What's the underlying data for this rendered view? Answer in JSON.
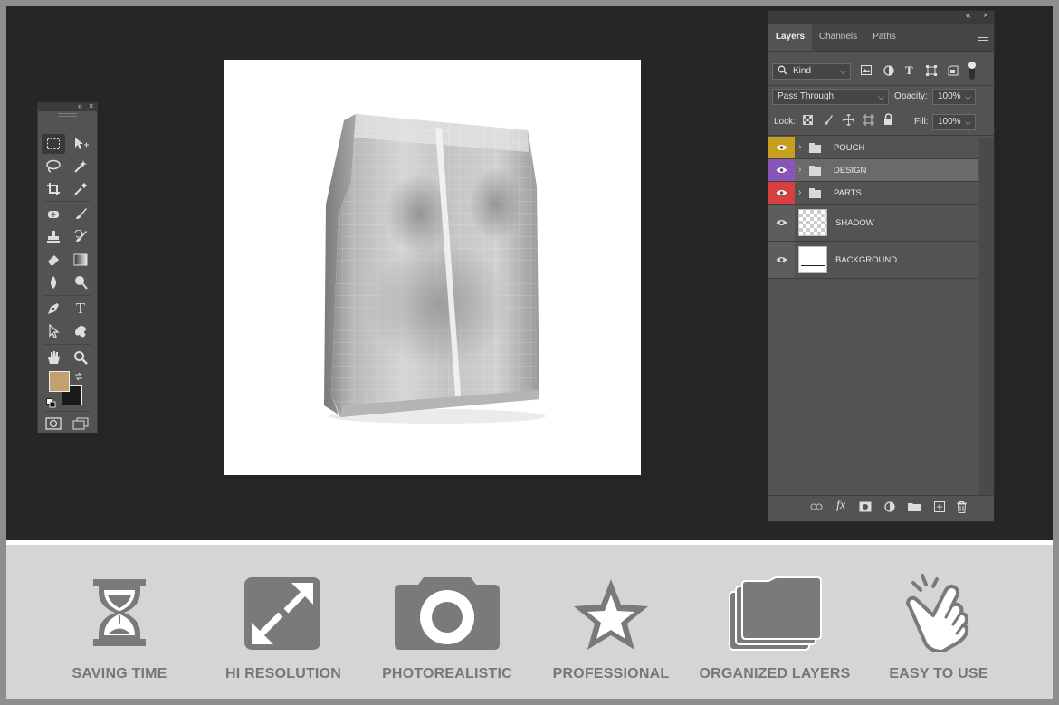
{
  "colors": {
    "workspace": "#262626",
    "panel": "#535353",
    "banner": "#d5d5d5",
    "banner_icon": "#7a7a7a",
    "foreground_swatch": "#c4a070",
    "background_swatch": "#1a1a1a",
    "layer_pouch": "#c8a020",
    "layer_design": "#8a55b8",
    "layer_parts": "#d84040"
  },
  "toolbox": {
    "collapse_glyph": "«",
    "close_glyph": "×",
    "text_tool_glyph": "T",
    "tools": [
      "rectangular-marquee",
      "move",
      "lasso",
      "magic-wand",
      "crop",
      "eyedropper",
      "spot-healing",
      "brush",
      "clone-stamp",
      "history-brush",
      "eraser",
      "gradient",
      "blur",
      "dodge",
      "pen",
      "type",
      "path-selection",
      "custom-shape",
      "hand",
      "zoom",
      "quick-mask",
      "screen-mode"
    ]
  },
  "layers_panel": {
    "collapse_glyph": "«",
    "close_glyph": "×",
    "tabs": [
      {
        "label": "Layers",
        "active": true
      },
      {
        "label": "Channels",
        "active": false
      },
      {
        "label": "Paths",
        "active": false
      }
    ],
    "filter": {
      "label": "Kind"
    },
    "type_glyph": "T",
    "blend_mode": "Pass Through",
    "opacity_label": "Opacity:",
    "opacity_value": "100%",
    "lock_label": "Lock:",
    "fill_label": "Fill:",
    "fill_value": "100%",
    "fx_label": "fx",
    "layers": [
      {
        "name": "POUCH",
        "type": "group",
        "color": "#c8a020",
        "selected": false
      },
      {
        "name": "DESIGN",
        "type": "group",
        "color": "#8a55b8",
        "selected": true
      },
      {
        "name": "PARTS",
        "type": "group",
        "color": "#d84040",
        "selected": false
      },
      {
        "name": "SHADOW",
        "type": "pixel",
        "color": "",
        "selected": false
      },
      {
        "name": "BACKGROUND",
        "type": "pixel",
        "color": "",
        "selected": false
      }
    ]
  },
  "features": [
    {
      "label": "SAVING TIME",
      "icon": "hourglass-icon"
    },
    {
      "label": "HI RESOLUTION",
      "icon": "expand-arrows-icon"
    },
    {
      "label": "PHOTOREALISTIC",
      "icon": "camera-icon"
    },
    {
      "label": "PROFESSIONAL",
      "icon": "star-icon"
    },
    {
      "label": "ORGANIZED LAYERS",
      "icon": "folders-icon"
    },
    {
      "label": "EASY TO USE",
      "icon": "tap-hand-icon"
    }
  ]
}
